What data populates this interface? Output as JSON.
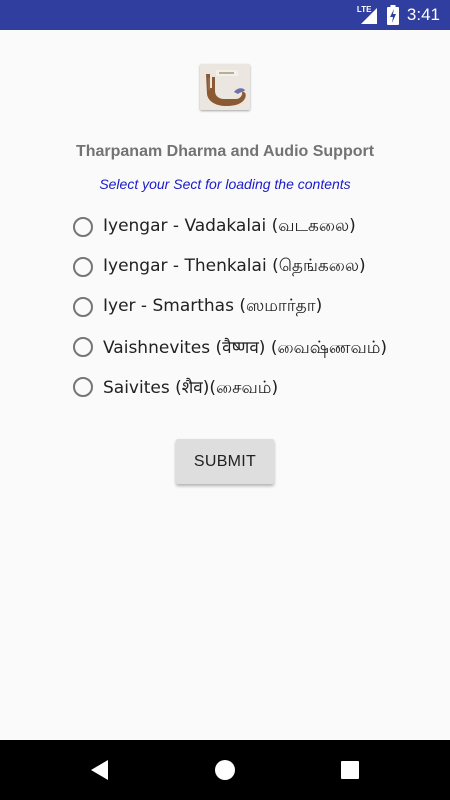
{
  "status_bar": {
    "network_label": "LTE",
    "time": "3:41",
    "color": "#303f9f"
  },
  "header": {
    "logo_icon": "tharpanam-hand-icon",
    "title": "Tharpanam Dharma and Audio Support",
    "subtitle": "Select your Sect for loading the contents",
    "subtitle_color": "#1a1acc"
  },
  "sects": [
    {
      "label": "Iyengar - Vadakalai (வடகலை)",
      "selected": false
    },
    {
      "label": "Iyengar - Thenkalai (தெங்கலை)",
      "selected": false
    },
    {
      "label": "Iyer - Smarthas (ஸமார்தா)",
      "selected": false
    },
    {
      "label": "Vaishnevites (वैष्णव) (வைஷ்ணவம்)",
      "selected": false
    },
    {
      "label": "Saivites (शैव)(சைவம்)",
      "selected": false
    }
  ],
  "actions": {
    "submit_label": "SUBMIT"
  },
  "nav_bar": {
    "back_icon": "back-triangle-icon",
    "home_icon": "home-circle-icon",
    "recents_icon": "recents-square-icon"
  }
}
